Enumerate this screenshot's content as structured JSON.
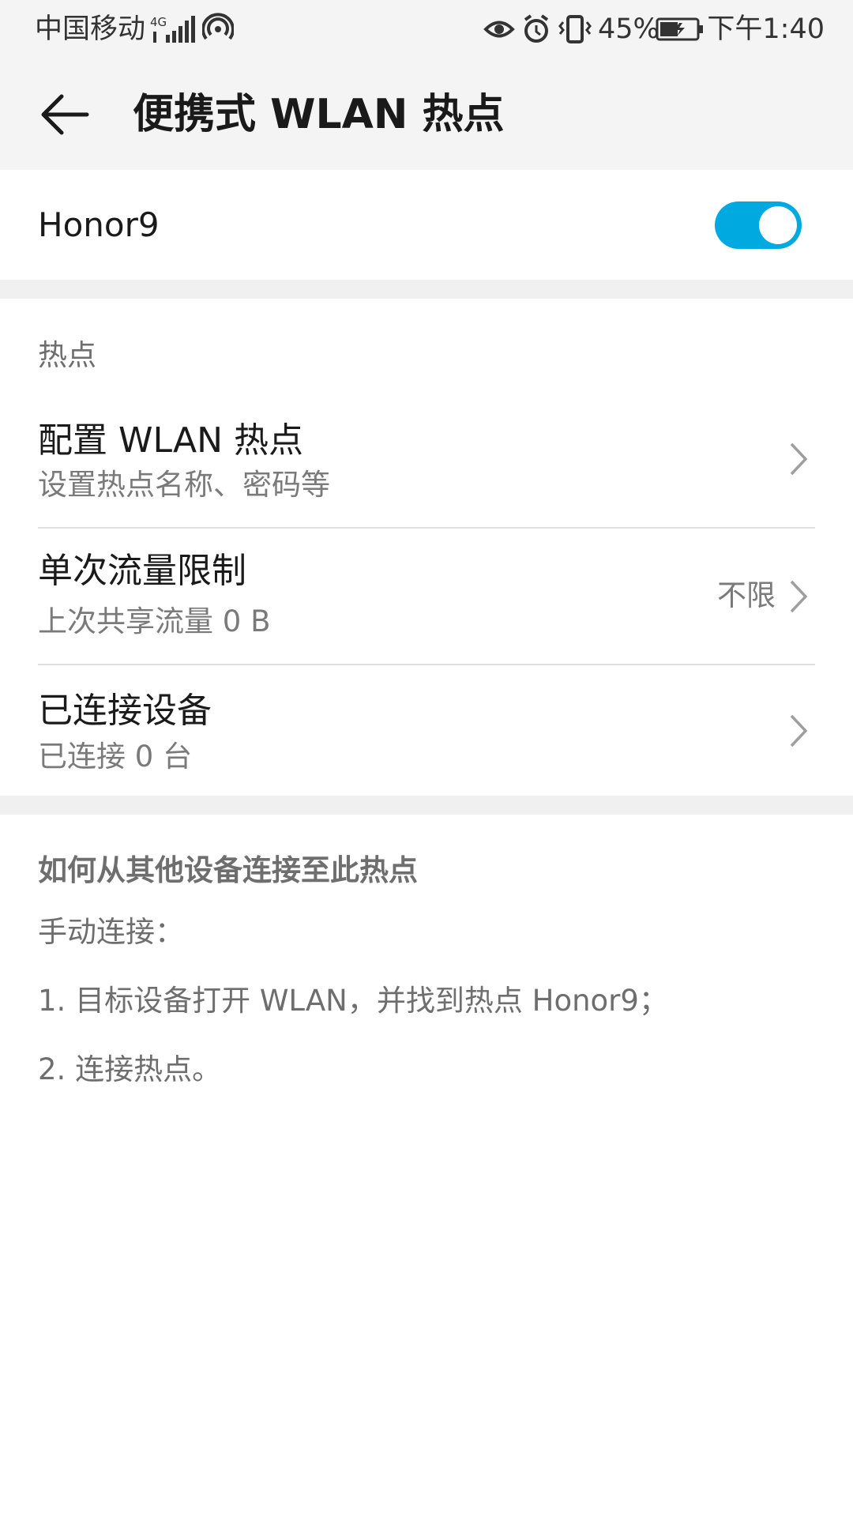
{
  "status_bar": {
    "carrier": "中国移动",
    "network": "4G",
    "battery_percent": "45%",
    "time": "下午1:40",
    "icons": [
      "signal-icon",
      "hotspot-icon",
      "eye-icon",
      "alarm-icon",
      "vibrate-icon",
      "battery-icon"
    ]
  },
  "app_bar": {
    "back_icon": "back-arrow-icon",
    "title": "便携式 WLAN 热点"
  },
  "hotspot_toggle": {
    "label": "Honor9",
    "enabled": true,
    "accent_color": "#00a9e0"
  },
  "section": {
    "header": "热点",
    "items": [
      {
        "title": "配置 WLAN 热点",
        "subtitle": "设置热点名称、密码等",
        "value": ""
      },
      {
        "title": "单次流量限制",
        "subtitle": "上次共享流量 0 B",
        "value": "不限"
      },
      {
        "title": "已连接设备",
        "subtitle": "已连接 0 台",
        "value": ""
      }
    ]
  },
  "help": {
    "heading": "如何从其他设备连接至此热点",
    "manual": "手动连接：",
    "step1": "1. 目标设备打开 WLAN，并找到热点 Honor9；",
    "step2": "2. 连接热点。"
  }
}
